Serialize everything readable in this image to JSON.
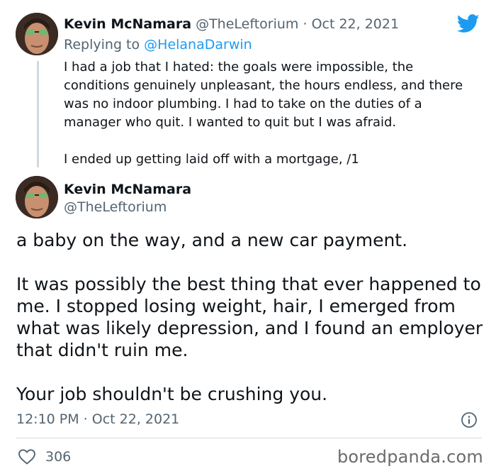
{
  "parent_tweet": {
    "author_name": "Kevin McNamara",
    "author_handle": "@TheLeftorium",
    "date": "· Oct 22, 2021",
    "replying_prefix": "Replying to ",
    "replying_to": "@HelanaDarwin",
    "text": "I had a job that I hated: the goals were impossible, the conditions genuinely unpleasant, the hours endless, and there was no indoor plumbing. I had to take on the duties of a manager who quit.  I wanted to quit but I was afraid.\n\nI ended up getting laid off with a mortgage, /1"
  },
  "main_tweet": {
    "author_name": "Kevin McNamara",
    "author_handle": "@TheLeftorium",
    "text": "a baby on the way, and a new car payment.\n\nIt was possibly the best thing that ever happened to me.  I stopped losing weight, hair, I emerged from what was likely depression, and I found an employer that didn't ruin me.\n\nYour job shouldn't be crushing you.",
    "timestamp": "12:10 PM · Oct 22, 2021",
    "likes": "306"
  },
  "watermark": "boredpanda.com",
  "icons": {
    "brand": "twitter-bird-icon",
    "info": "info-icon",
    "like": "heart-icon"
  },
  "colors": {
    "brand_blue": "#1d9bf0",
    "muted": "#536471",
    "divider": "#cfd9de"
  }
}
